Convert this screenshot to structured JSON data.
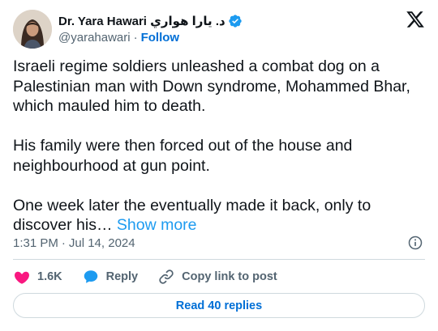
{
  "author": {
    "display_name": "Dr. Yara Hawari د. يارا هواري",
    "handle": "@yarahawari",
    "separator": "·",
    "follow_label": "Follow"
  },
  "tweet": {
    "text": "Israeli regime soldiers unleashed a combat dog on a Palestinian man with Down syndrome, Mohammed Bhar, which mauled him to death.\n\nHis family were then forced out of the house and neighbourhood at gun point.\n\nOne week later the eventually made it back, only to discover his… ",
    "show_more_label": "Show more"
  },
  "meta": {
    "time": "1:31 PM",
    "separator": "·",
    "date": "Jul 14, 2024"
  },
  "actions": {
    "like_count": "1.6K",
    "reply_label": "Reply",
    "copy_link_label": "Copy link to post"
  },
  "replies_button": {
    "label": "Read 40 replies"
  },
  "icons": {
    "verified": "verified-badge-icon",
    "x_logo": "x-logo-icon",
    "info": "info-icon",
    "like": "heart-icon",
    "reply": "speech-bubble-icon",
    "copy_link": "link-icon"
  },
  "colors": {
    "accent": "#1d9bf0",
    "follow": "#006fd6",
    "like": "#f91880",
    "secondary_text": "#536471",
    "border": "#cfd9de"
  }
}
